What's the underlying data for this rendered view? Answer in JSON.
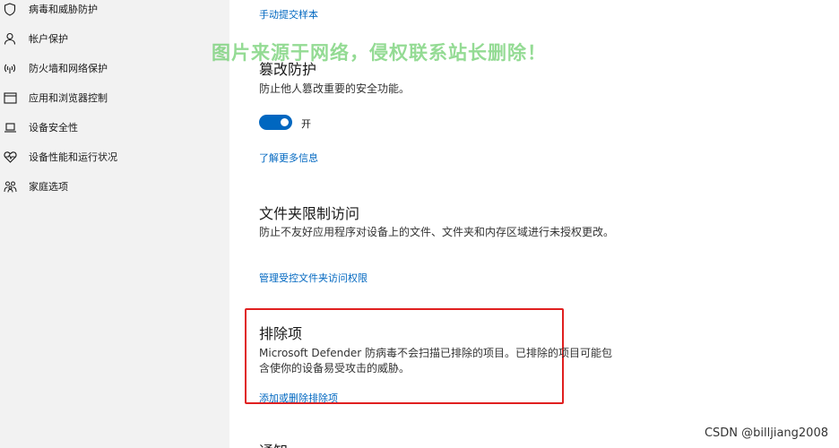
{
  "sidebar": {
    "items": [
      {
        "label": "病毒和威胁防护",
        "icon": "shield-icon"
      },
      {
        "label": "帐户保护",
        "icon": "person-icon"
      },
      {
        "label": "防火墙和网络保护",
        "icon": "wifi-antenna-icon"
      },
      {
        "label": "应用和浏览器控制",
        "icon": "app-window-icon"
      },
      {
        "label": "设备安全性",
        "icon": "laptop-icon"
      },
      {
        "label": "设备性能和运行状况",
        "icon": "heart-pulse-icon"
      },
      {
        "label": "家庭选项",
        "icon": "family-icon"
      }
    ]
  },
  "main": {
    "submit_sample_link": "手动提交样本",
    "tamper": {
      "title": "篡改防护",
      "description": "防止他人篡改重要的安全功能。",
      "toggle_state": "开",
      "toggle_on": true,
      "learn_more_link": "了解更多信息"
    },
    "folder_access": {
      "title": "文件夹限制访问",
      "description": "防止不友好应用程序对设备上的文件、文件夹和内存区域进行未授权更改。",
      "manage_link": "管理受控文件夹访问权限"
    },
    "exclusions": {
      "title": "排除项",
      "description": "Microsoft Defender 防病毒不会扫描已排除的项目。已排除的项目可能包含使你的设备易受攻击的威胁。",
      "add_remove_link": "添加或删除排除项"
    },
    "next_section_title": "通知"
  },
  "watermark": "图片来源于网络，侵权联系站长删除！",
  "credit": "CSDN @billjiang2008",
  "colors": {
    "accent": "#0067c0",
    "highlight_border": "#e02020",
    "sidebar_bg": "#f2f2f2",
    "watermark": "#5ac85a"
  }
}
